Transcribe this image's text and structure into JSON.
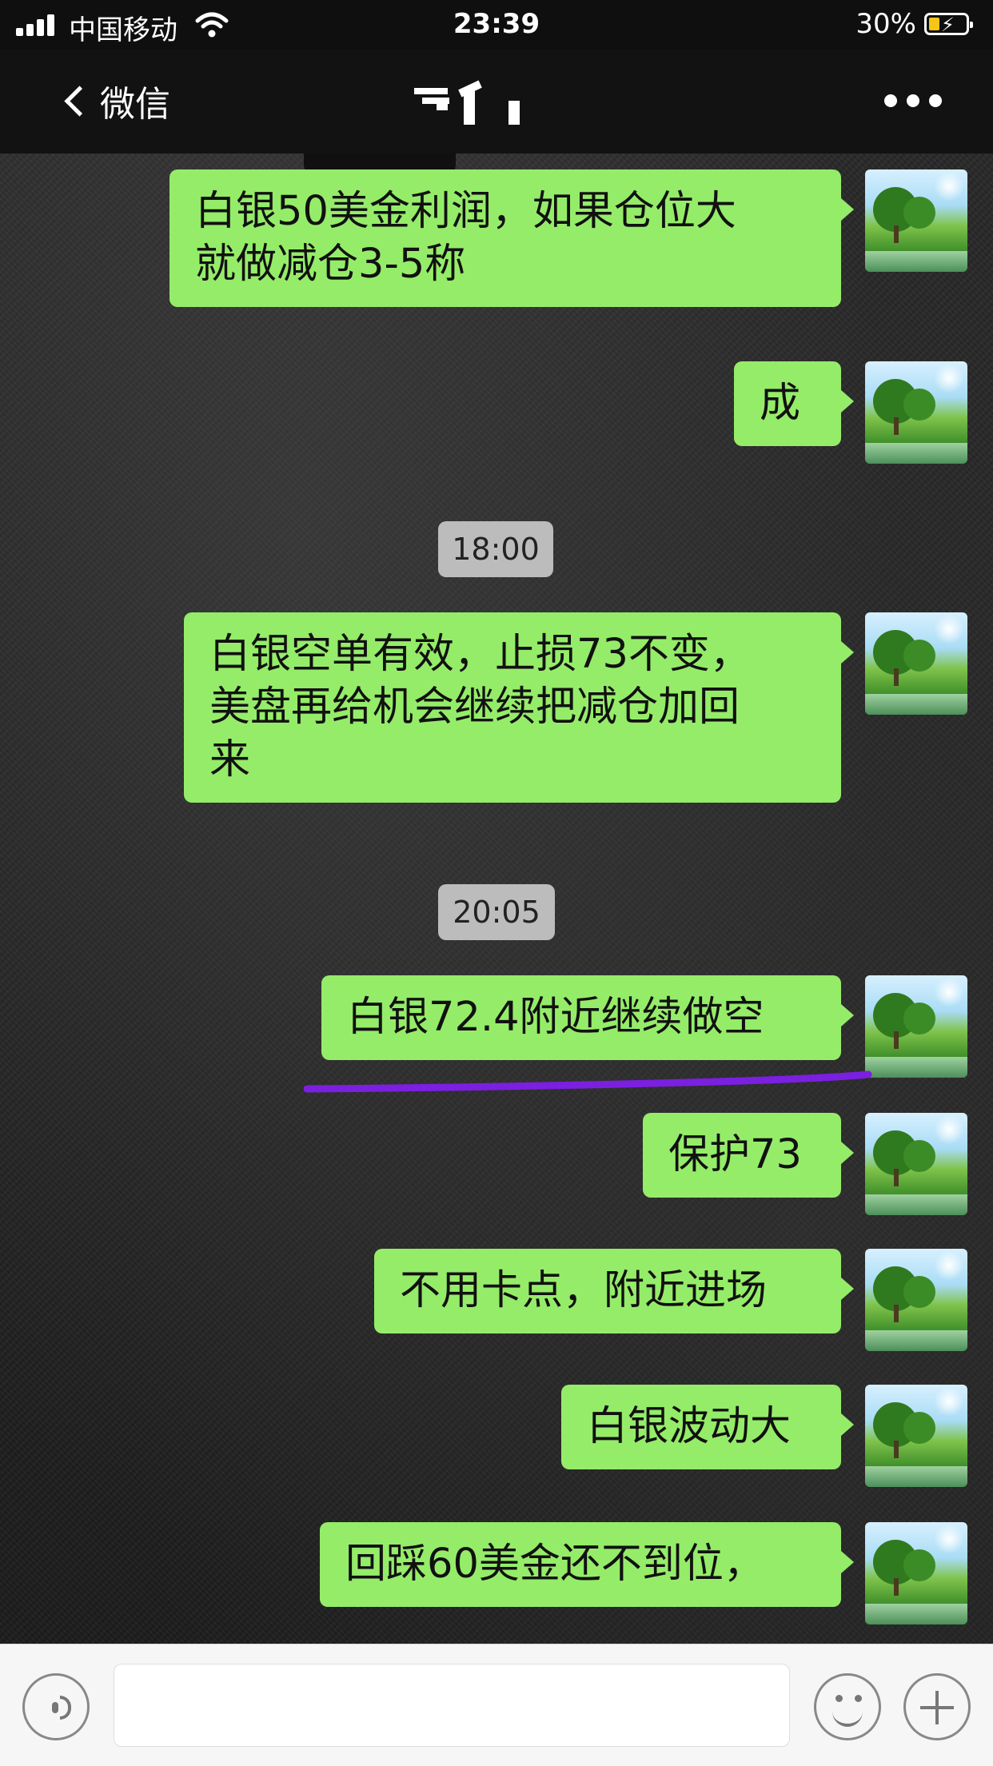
{
  "status_bar": {
    "carrier": "中国移动",
    "time": "23:39",
    "battery_percent": "30%",
    "battery_level": 0.3,
    "charging": true,
    "signal_icon": "signal-bars-icon",
    "wifi_icon": "wifi-icon"
  },
  "nav": {
    "back_label": "微信",
    "title_redacted": true,
    "more_icon": "more-dots-icon"
  },
  "messages": [
    {
      "type": "text",
      "sender": "self",
      "lines": [
        "白银50美金利润，如果仓位大",
        "就做减仓3-5称"
      ]
    },
    {
      "type": "text",
      "sender": "self",
      "lines": [
        "成"
      ]
    },
    {
      "type": "time",
      "text": "18:00"
    },
    {
      "type": "text",
      "sender": "self",
      "lines": [
        "白银空单有效，止损73不变，",
        "美盘再给机会继续把减仓加回",
        "来"
      ]
    },
    {
      "type": "time",
      "text": "20:05"
    },
    {
      "type": "text",
      "sender": "self",
      "lines": [
        "白银72.4附近继续做空"
      ],
      "underlined": true
    },
    {
      "type": "text",
      "sender": "self",
      "lines": [
        "保护73"
      ]
    },
    {
      "type": "text",
      "sender": "self",
      "lines": [
        "不用卡点，附近进场"
      ]
    },
    {
      "type": "text",
      "sender": "self",
      "lines": [
        "白银波动大"
      ]
    },
    {
      "type": "text",
      "sender": "self",
      "lines": [
        "回踩60美金还不到位，"
      ]
    }
  ],
  "input_bar": {
    "voice_icon": "voice-icon",
    "emoji_icon": "emoji-icon",
    "plus_icon": "plus-icon",
    "text_value": ""
  },
  "colors": {
    "bubble_green": "#95ec69",
    "timestamp_bg": "#bcbcbc",
    "underline_purple": "#7b1fe0",
    "battery_yellow": "#f5c518"
  }
}
